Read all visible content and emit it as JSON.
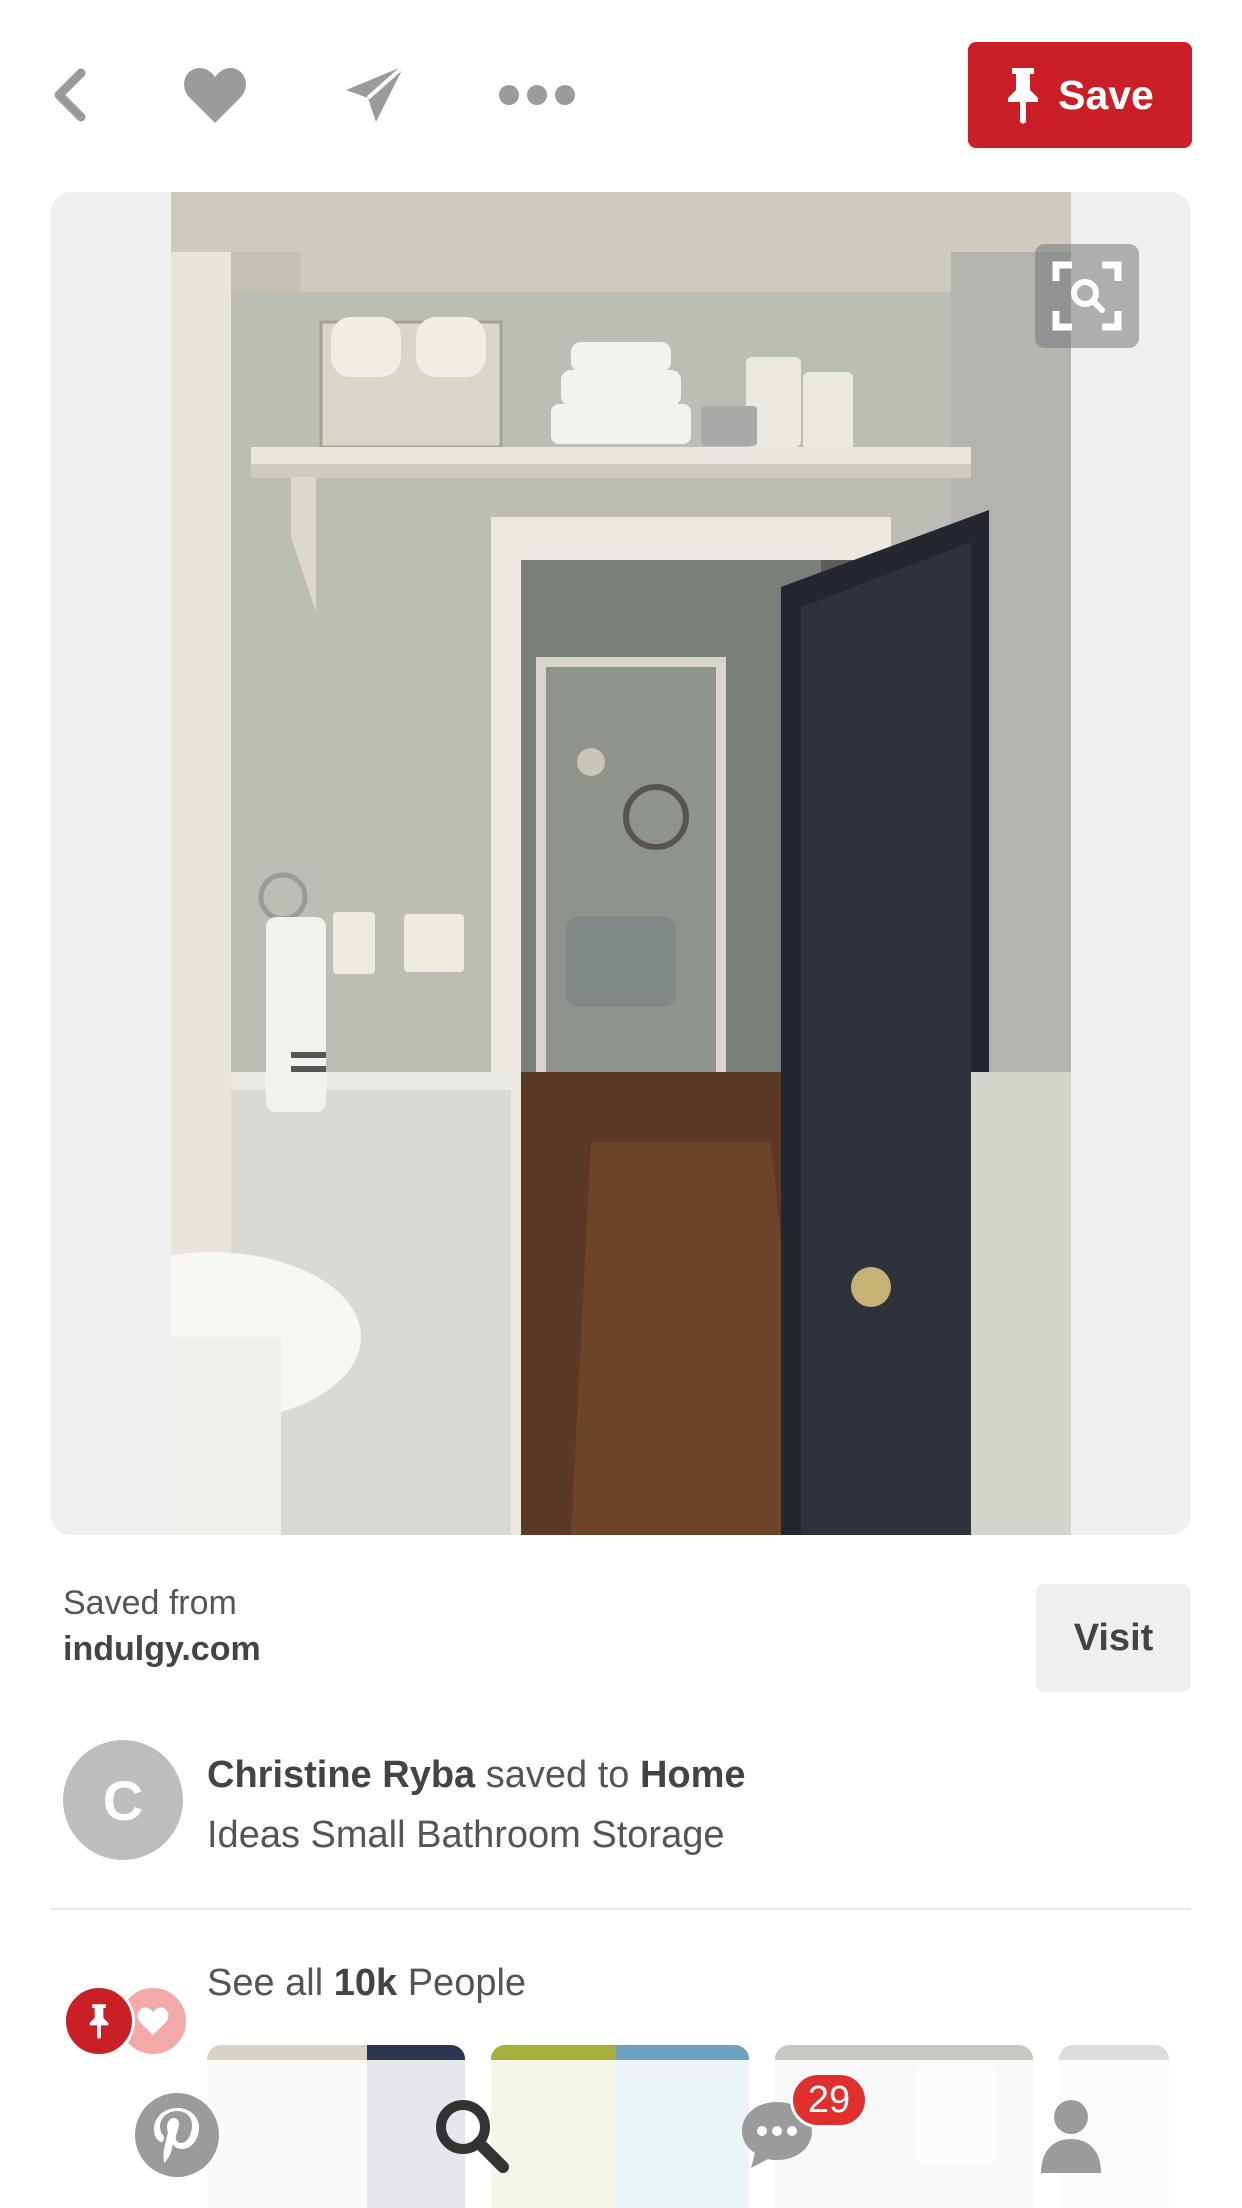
{
  "toolbar": {
    "back_icon": "chevron-left-icon",
    "like_icon": "heart-icon",
    "send_icon": "send-icon",
    "more_icon": "more-icon",
    "save_label": "Save"
  },
  "pin": {
    "image_alt": "Bathroom doorway with shelf above door holding towels, baskets and toilet paper",
    "lens_icon": "visual-search-icon"
  },
  "source": {
    "saved_from_label": "Saved from",
    "domain": "indulgy.com",
    "visit_label": "Visit"
  },
  "attribution": {
    "avatar_letter": "C",
    "user_name": "Christine Ryba",
    "saved_to_text": " saved to ",
    "board_name_bold": "Home",
    "board_name_rest": "Ideas Small Bathroom Storage"
  },
  "activity": {
    "see_all_prefix": "See all ",
    "count": "10k",
    "see_all_suffix": " People"
  },
  "tabbar": {
    "home_icon": "pinterest-icon",
    "search_icon": "search-icon",
    "messages_icon": "chat-icon",
    "notification_count": "29",
    "profile_icon": "profile-icon"
  },
  "colors": {
    "brand_red": "#cb1f27",
    "badge_red": "#e0302e",
    "icon_gray": "#9b9b9b"
  }
}
